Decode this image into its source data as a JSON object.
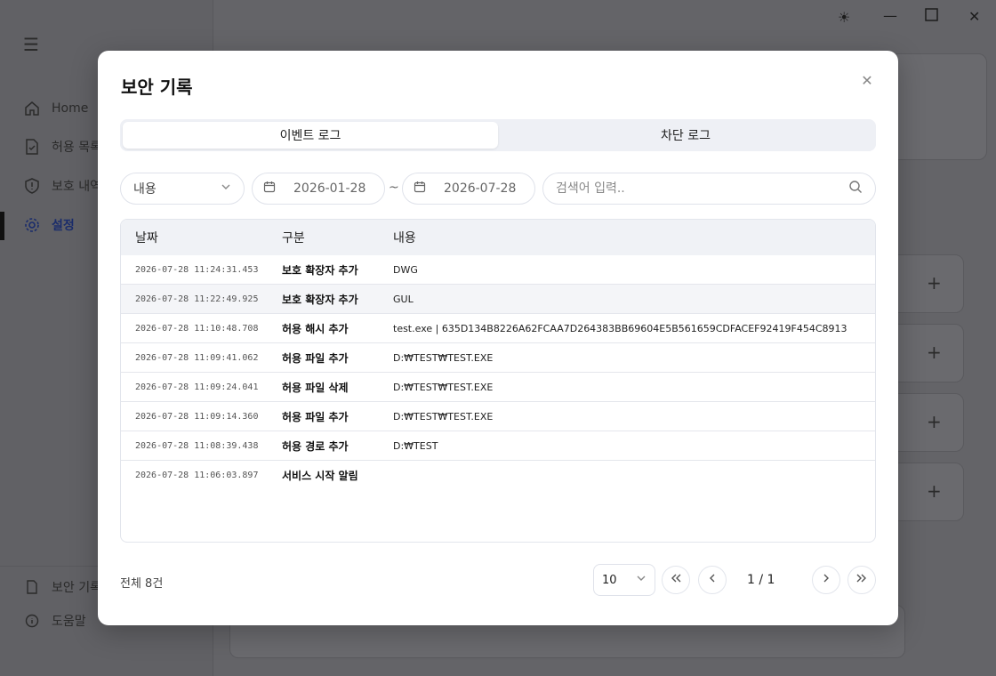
{
  "background": {
    "nav": [
      {
        "label": "Home"
      },
      {
        "label": "허용 목록"
      },
      {
        "label": "보호 내역"
      },
      {
        "label": "설정"
      }
    ],
    "footer": [
      {
        "label": "보안 기록"
      },
      {
        "label": "도움말"
      }
    ]
  },
  "modal": {
    "title": "보안 기록",
    "tabs": [
      {
        "label": "이벤트 로그",
        "active": true
      },
      {
        "label": "차단 로그",
        "active": false
      }
    ],
    "filter": {
      "type_value": "내용",
      "date_from": "2026-01-28",
      "date_sep": "~",
      "date_to": "2026-07-28",
      "search_placeholder": "검색어 입력.."
    },
    "table": {
      "headers": [
        "날짜",
        "구분",
        "내용"
      ],
      "rows": [
        {
          "date": "2026-07-28 11:24:31.453",
          "type": "보호 확장자 추가",
          "content": "DWG"
        },
        {
          "date": "2026-07-28 11:22:49.925",
          "type": "보호 확장자 추가",
          "content": "GUL"
        },
        {
          "date": "2026-07-28 11:10:48.708",
          "type": "허용 해시 추가",
          "content": "test.exe | 635D134B8226A62FCAA7D264383BB69604E5B561659CDFACEF92419F454C8913"
        },
        {
          "date": "2026-07-28 11:09:41.062",
          "type": "허용 파일 추가",
          "content": "D:₩TEST₩TEST.EXE"
        },
        {
          "date": "2026-07-28 11:09:24.041",
          "type": "허용 파일 삭제",
          "content": "D:₩TEST₩TEST.EXE"
        },
        {
          "date": "2026-07-28 11:09:14.360",
          "type": "허용 파일 추가",
          "content": "D:₩TEST₩TEST.EXE"
        },
        {
          "date": "2026-07-28 11:08:39.438",
          "type": "허용 경로 추가",
          "content": "D:₩TEST"
        },
        {
          "date": "2026-07-28 11:06:03.897",
          "type": "서비스 시작 알림",
          "content": ""
        }
      ]
    },
    "footer": {
      "total": "전체 8건",
      "page_size": "10",
      "page_info": "1 / 1"
    }
  }
}
